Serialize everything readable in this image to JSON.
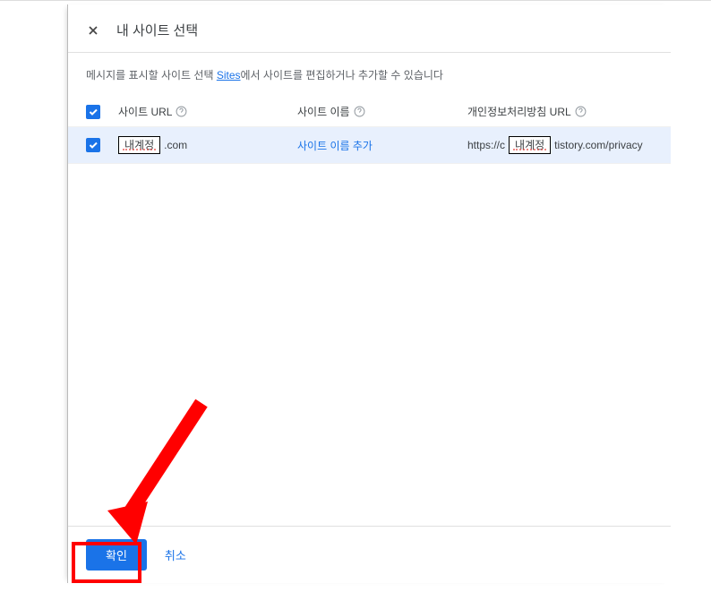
{
  "modal": {
    "title": "내 사이트 선택",
    "description_prefix": "메시지를 표시할 사이트 선택 ",
    "description_link": "Sites",
    "description_suffix": "에서 사이트를 편집하거나 추가할 수 있습니다"
  },
  "table": {
    "headers": {
      "url": "사이트 URL",
      "name": "사이트 이름",
      "privacy": "개인정보처리방침 URL"
    },
    "row": {
      "url_redacted": "내계정",
      "url_suffix": ".com",
      "add_name": "사이트 이름 추가",
      "privacy_prefix": "https://c",
      "privacy_redacted": "내계정",
      "privacy_suffix": "tistory.com/privacy"
    }
  },
  "footer": {
    "confirm": "확인",
    "cancel": "취소"
  }
}
